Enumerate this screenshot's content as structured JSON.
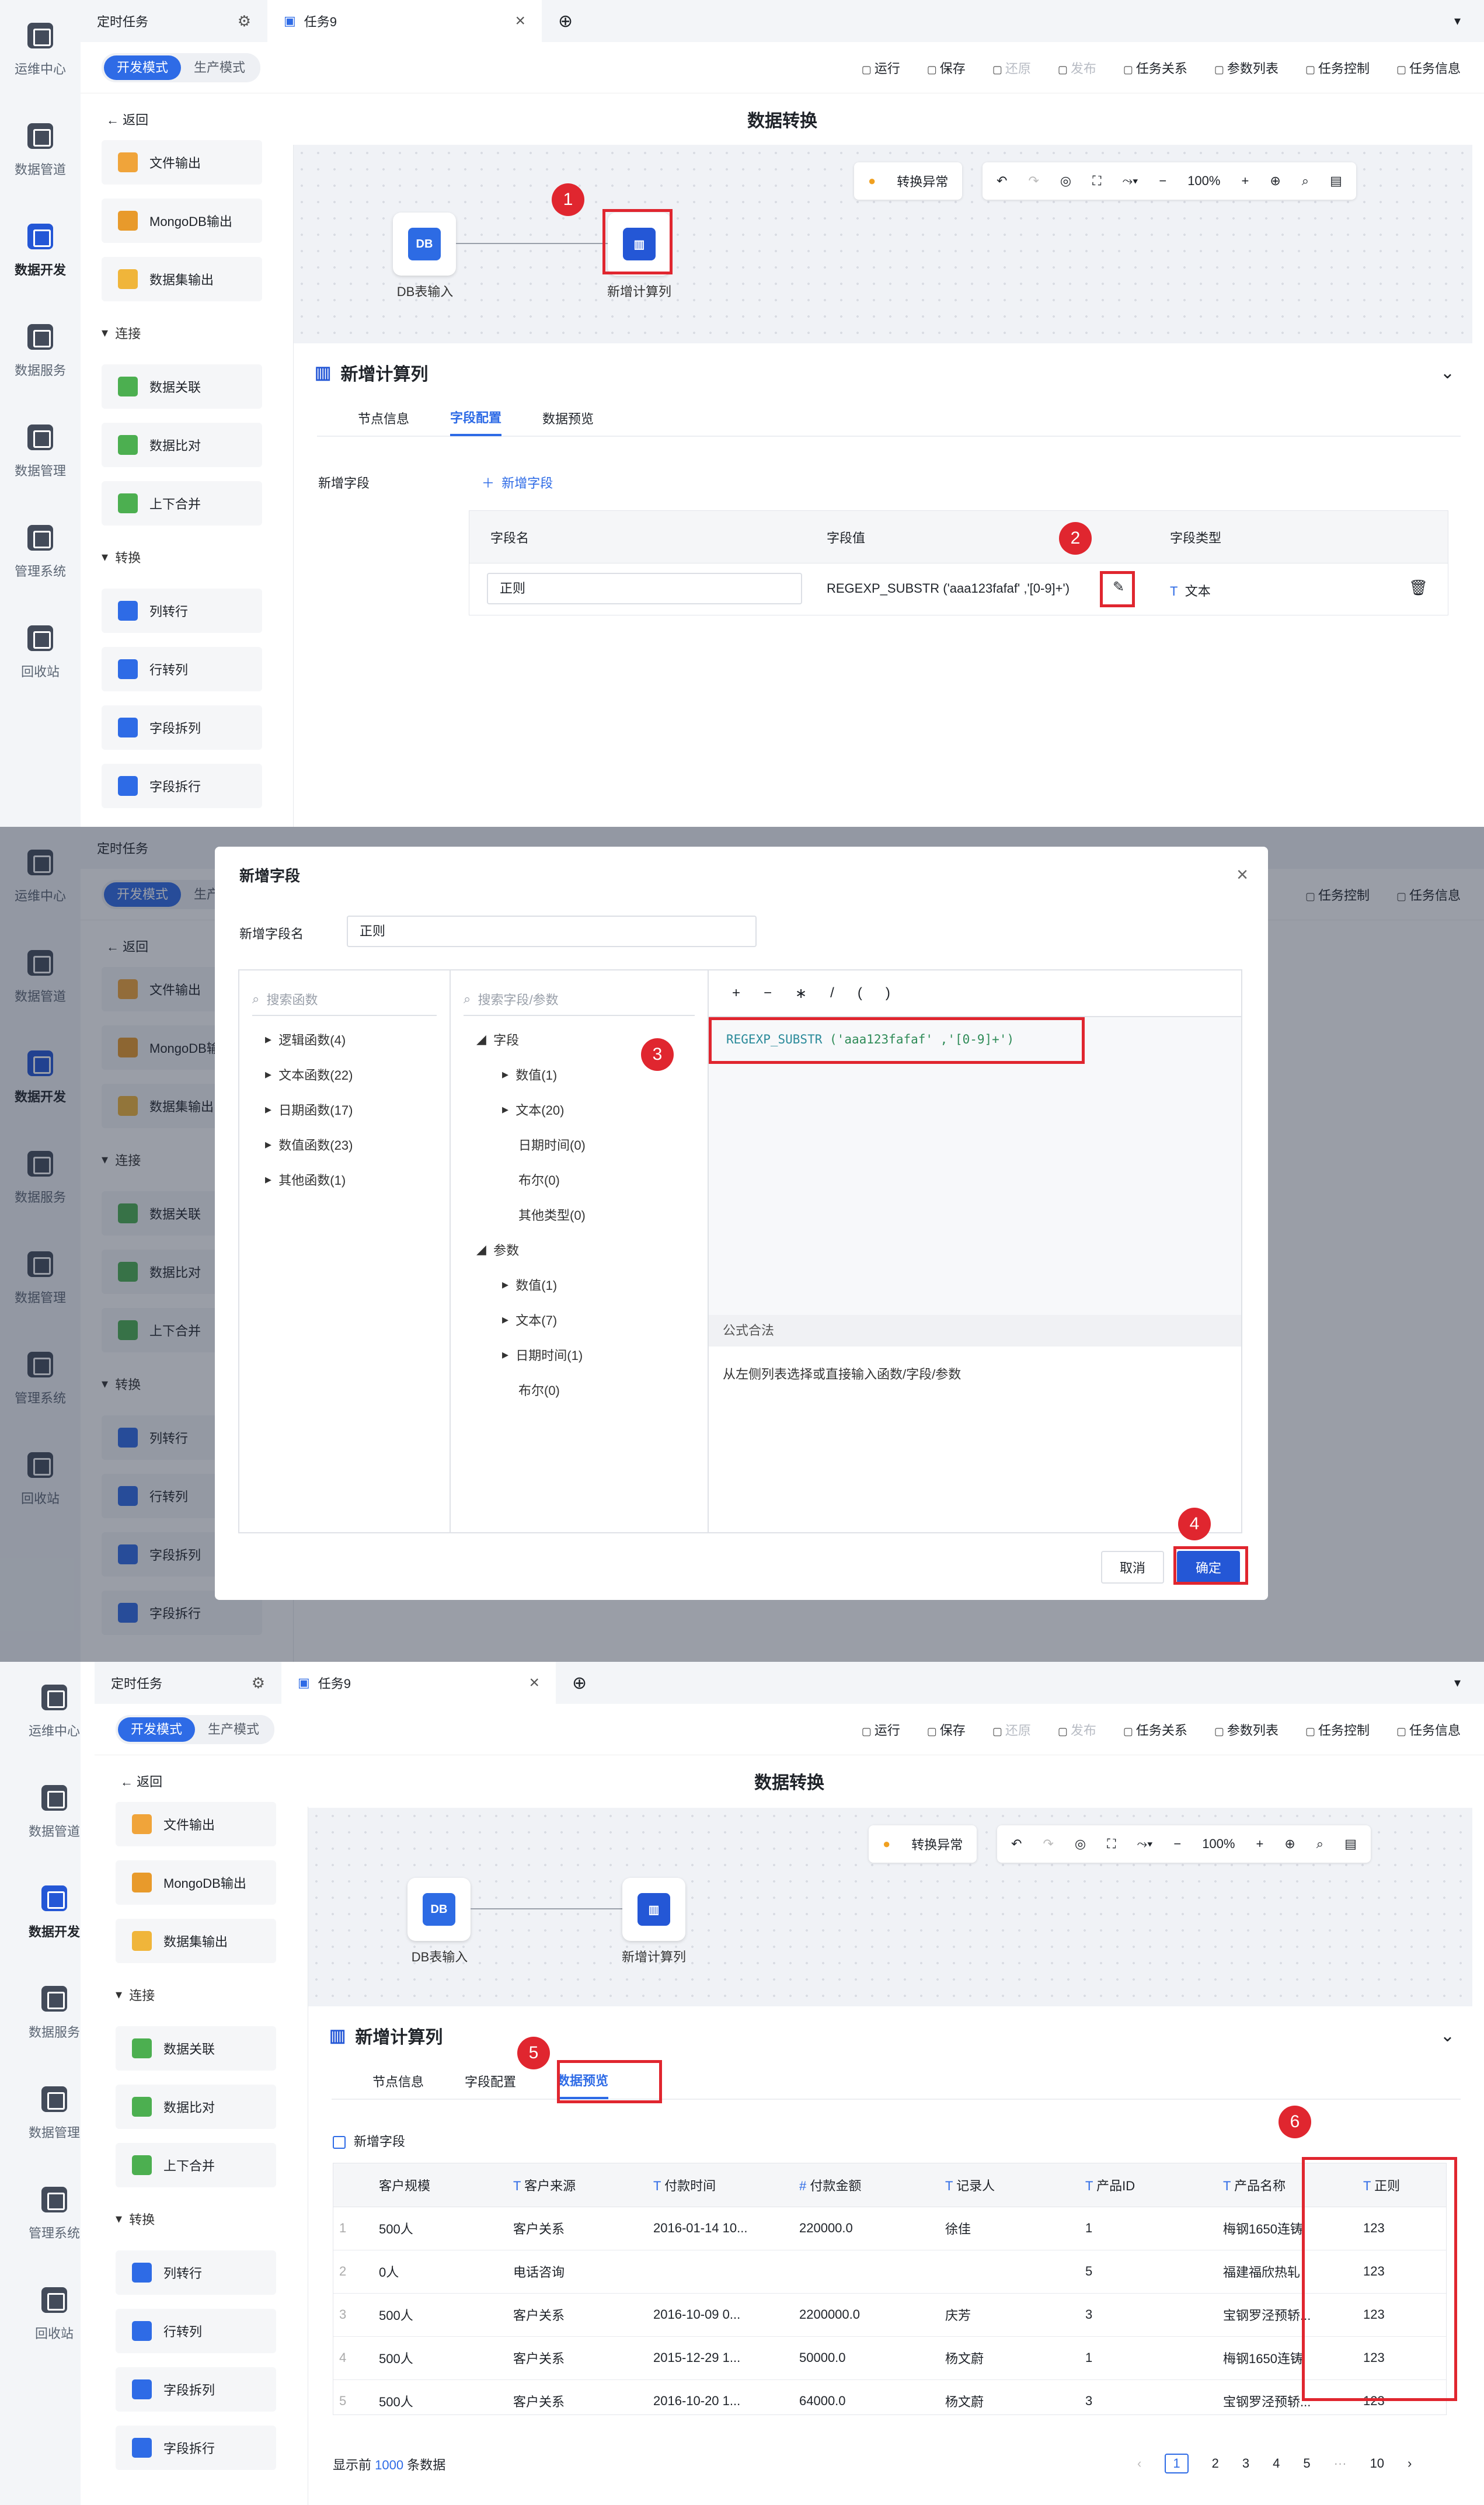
{
  "rail": [
    {
      "label": "运维中心"
    },
    {
      "label": "数据管道"
    },
    {
      "label": "数据开发"
    },
    {
      "label": "数据服务"
    },
    {
      "label": "数据管理"
    },
    {
      "label": "管理系统"
    },
    {
      "label": "回收站"
    }
  ],
  "tabs": {
    "scheduled": "定时任务",
    "task": "任务9"
  },
  "modes": {
    "dev": "开发模式",
    "prod": "生产模式"
  },
  "tools": [
    "运行",
    "保存",
    "还原",
    "发布",
    "任务关系",
    "参数列表",
    "任务控制",
    "任务信息"
  ],
  "back": "返回",
  "page_title": "数据转换",
  "side": {
    "items_top": [
      "文件输出",
      "MongoDB输出",
      "数据集输出"
    ],
    "group_connect": "连接",
    "items_connect": [
      "数据关联",
      "数据比对",
      "上下合并"
    ],
    "group_transform": "转换",
    "items_transform": [
      "列转行",
      "行转列",
      "字段拆列",
      "字段拆行"
    ]
  },
  "canvas": {
    "exception": "转换异常",
    "zoom": "100%",
    "node_input": "DB表输入",
    "node_calc": "新增计算列",
    "db_glyph": "DB"
  },
  "detail": {
    "title": "新增计算列",
    "tabs": [
      "节点信息",
      "字段配置",
      "数据预览"
    ],
    "add_field_label": "新增字段",
    "add_field_btn": "新增字段",
    "col_name": "字段名",
    "col_value": "字段值",
    "col_type": "字段类型",
    "row_name": "正则",
    "row_value": "REGEXP_SUBSTR ('aaa123fafaf' ,'[0-9]+')",
    "row_type": "文本"
  },
  "modal": {
    "title": "新增字段",
    "name_label": "新增字段名",
    "name_value": "正则",
    "search_func": "搜索函数",
    "search_field": "搜索字段/参数",
    "funcs": [
      "逻辑函数(4)",
      "文本函数(22)",
      "日期函数(17)",
      "数值函数(23)",
      "其他函数(1)"
    ],
    "field_root": "字段",
    "fields": [
      "数值(1)",
      "文本(20)",
      "日期时间(0)",
      "布尔(0)",
      "其他类型(0)"
    ],
    "param_root": "参数",
    "params": [
      "数值(1)",
      "文本(7)",
      "日期时间(1)",
      "布尔(0)"
    ],
    "ops": [
      "+",
      "−",
      "∗",
      "/",
      "(",
      ")"
    ],
    "formula_fn": "REGEXP_SUBSTR",
    "formula_args": "('aaa123fafaf' ,'[0-9]+')",
    "valid": "公式合法",
    "hint": "从左侧列表选择或直接输入函数/字段/参数",
    "cancel": "取消",
    "ok": "确定"
  },
  "badges": [
    "1",
    "2",
    "3",
    "4",
    "5",
    "6"
  ],
  "preview": {
    "checkbox": "新增字段",
    "headers": [
      "客户规模",
      "客户来源",
      "付款时间",
      "付款金额",
      "记录人",
      "产品ID",
      "产品名称",
      "正则"
    ],
    "rows": [
      [
        "1",
        "500人",
        "客户关系",
        "2016-01-14 10...",
        "220000.0",
        "徐佳",
        "1",
        "梅钢1650连铸",
        "123"
      ],
      [
        "2",
        "0人",
        "电话咨询",
        "",
        "",
        "",
        "5",
        "福建福欣热轧",
        "123"
      ],
      [
        "3",
        "500人",
        "客户关系",
        "2016-10-09 0...",
        "2200000.0",
        "庆芳",
        "3",
        "宝钢罗泾预轿...",
        "123"
      ],
      [
        "4",
        "500人",
        "客户关系",
        "2015-12-29 1...",
        "50000.0",
        "杨文蔚",
        "1",
        "梅钢1650连铸",
        "123"
      ],
      [
        "5",
        "500人",
        "客户关系",
        "2016-10-20 1...",
        "64000.0",
        "杨文蔚",
        "3",
        "宝钢罗泾预轿...",
        "123"
      ]
    ],
    "footer_pre": "显示前",
    "footer_num": "1000",
    "footer_post": "条数据",
    "pages": [
      "1",
      "2",
      "3",
      "4",
      "5",
      "···",
      "10"
    ]
  }
}
